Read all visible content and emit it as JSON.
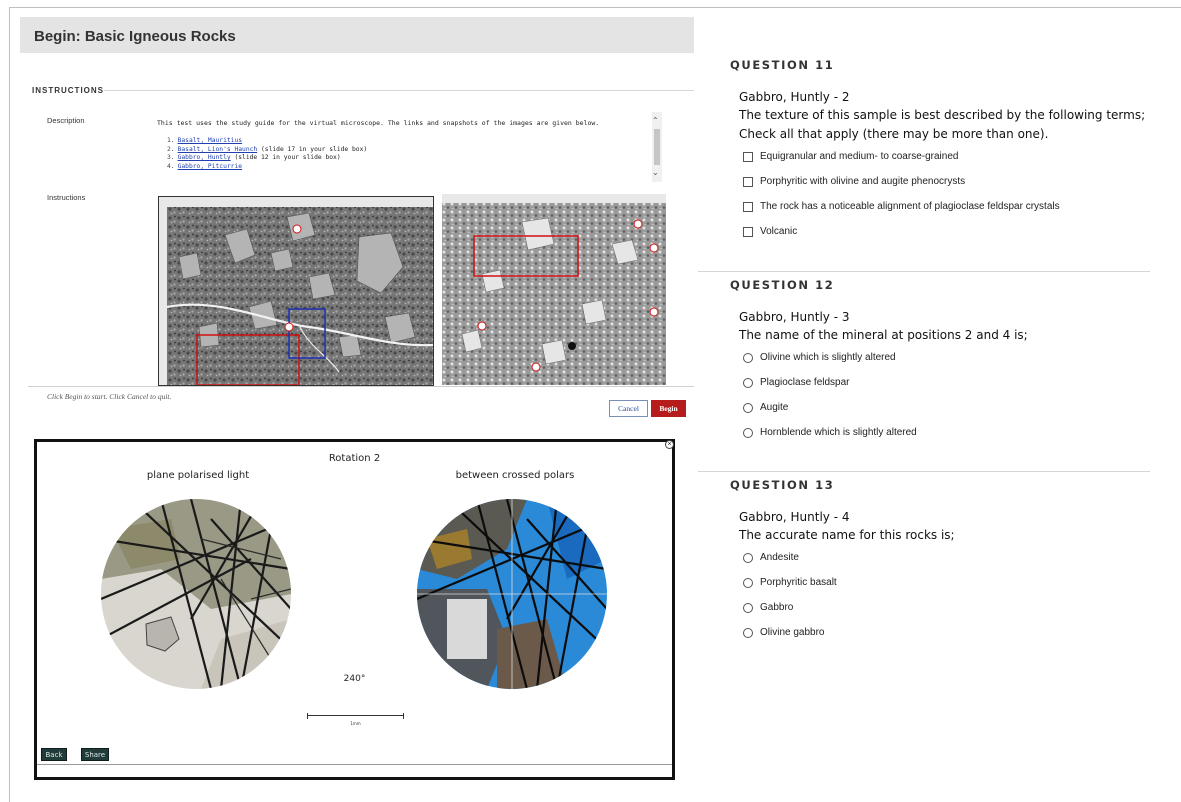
{
  "test": {
    "title": "Begin: Basic Igneous Rocks",
    "instructions_heading": "INSTRUCTIONS",
    "description_label": "Description",
    "instructions_label": "Instructions",
    "description_text": "This test uses the study guide for the virtual microscope. The links and snapshots of the images are given below.",
    "links": [
      {
        "num": "1.",
        "link": "Basalt, Mauritius",
        "note": ""
      },
      {
        "num": "2.",
        "link": "Basalt, Lion's Haunch",
        "note": " (slide 17 in your slide box)"
      },
      {
        "num": "3.",
        "link": "Gabbro, Huntly",
        "note": " (slide 12 in your slide box)"
      },
      {
        "num": "4.",
        "link": "Gabbro, Pitcurrie",
        "note": ""
      }
    ],
    "hint": "Click Begin to start. Click Cancel to quit.",
    "cancel_label": "Cancel",
    "begin_label": "Begin"
  },
  "viewer": {
    "title": "Rotation 2",
    "left_label": "plane polarised light",
    "right_label": "between crossed polars",
    "angle": "240°",
    "scale_label": "1mm",
    "back_label": "Back",
    "share_label": "Share"
  },
  "questions": [
    {
      "number": "QUESTION 11",
      "heading": "Gabbro, Huntly - 2",
      "text": "The texture of this sample is best described by the following terms; Check all that apply (there may be more than one).",
      "type": "checkbox",
      "options": [
        "Equigranular and medium- to coarse-grained",
        "Porphyritic with olivine and augite phenocrysts",
        "The rock has a noticeable alignment of plagioclase feldspar crystals",
        "Volcanic"
      ]
    },
    {
      "number": "QUESTION 12",
      "heading": "Gabbro, Huntly - 3",
      "text": "The name of the mineral at positions 2 and 4 is;",
      "type": "radio",
      "options": [
        "Olivine which is slightly altered",
        "Plagioclase feldspar",
        "Augite",
        "Hornblende which is slightly altered"
      ]
    },
    {
      "number": "QUESTION 13",
      "heading": "Gabbro, Huntly - 4",
      "text": "The accurate name for this rocks is;",
      "type": "radio",
      "options": [
        "Andesite",
        "Porphyritic basalt",
        "Gabbro",
        "Olivine gabbro"
      ]
    }
  ],
  "colors": {
    "begin_button": "#b71c1c",
    "link": "#1f3fb0",
    "highlight_red": "#d01010",
    "highlight_blue": "#1a2fb0",
    "xpl_blue": "#2a8ad8"
  },
  "icons": [
    "close-icon",
    "scroll-up-icon",
    "scroll-down-icon",
    "checkbox-icon",
    "radio-icon"
  ]
}
